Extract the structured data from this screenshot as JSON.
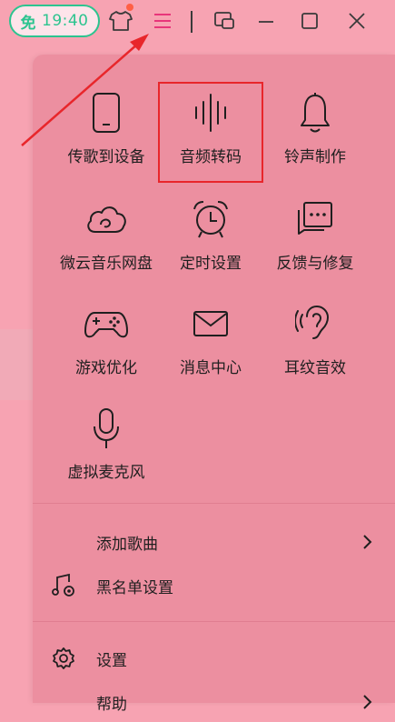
{
  "titlebar": {
    "badge_char": "免",
    "badge_time": "19:40"
  },
  "colors": {
    "accent_green": "#2cc48f",
    "menu_active": "#e8357a",
    "highlight_red": "#e8262b",
    "notification_dot": "#ff5f45"
  },
  "grid": [
    {
      "label": "传歌到设备",
      "icon": "phone-icon"
    },
    {
      "label": "音频转码",
      "icon": "waveform-icon"
    },
    {
      "label": "铃声制作",
      "icon": "bell-icon"
    },
    {
      "label": "微云音乐网盘",
      "icon": "cloud-icon"
    },
    {
      "label": "定时设置",
      "icon": "alarm-clock-icon"
    },
    {
      "label": "反馈与修复",
      "icon": "feedback-icon"
    },
    {
      "label": "游戏优化",
      "icon": "gamepad-icon"
    },
    {
      "label": "消息中心",
      "icon": "mail-icon"
    },
    {
      "label": "耳纹音效",
      "icon": "ear-icon"
    },
    {
      "label": "虚拟麦克风",
      "icon": "microphone-icon"
    }
  ],
  "list": [
    {
      "label": "添加歌曲",
      "icon": "",
      "has_chevron": true
    },
    {
      "label": "黑名单设置",
      "icon": "music-settings-icon",
      "has_chevron": false
    },
    {
      "label": "设置",
      "icon": "gear-icon",
      "has_chevron": false
    },
    {
      "label": "帮助",
      "icon": "",
      "has_chevron": true
    }
  ]
}
